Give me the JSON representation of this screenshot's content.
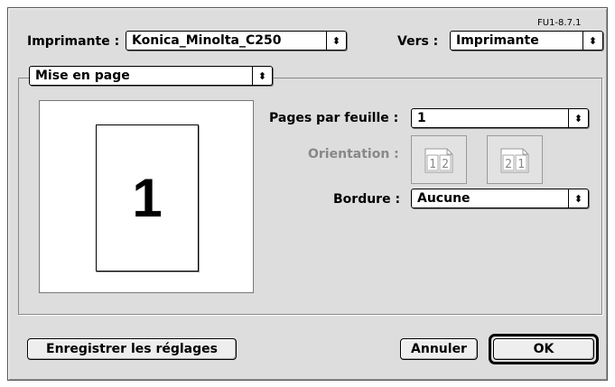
{
  "version_label": "FU1-8.7.1",
  "printer": {
    "label": "Imprimante :",
    "value": "Konica_Minolta_C250"
  },
  "destination": {
    "label": "Vers :",
    "value": "Imprimante"
  },
  "panel_menu": {
    "value": "Mise en page"
  },
  "preview": {
    "page_number": "1"
  },
  "pages_per_sheet": {
    "label": "Pages par feuille :",
    "value": "1"
  },
  "orientation": {
    "label": "Orientation :",
    "option_left_to_right": [
      "1",
      "2"
    ],
    "option_right_to_left": [
      "2",
      "1"
    ]
  },
  "border": {
    "label": "Bordure :",
    "value": "Aucune"
  },
  "footer": {
    "save_settings_label": "Enregistrer les réglages",
    "cancel_label": "Annuler",
    "ok_label": "OK"
  },
  "icons": {
    "popup_arrows": "up-down-arrows-icon",
    "updown_glyph": "⬍"
  }
}
